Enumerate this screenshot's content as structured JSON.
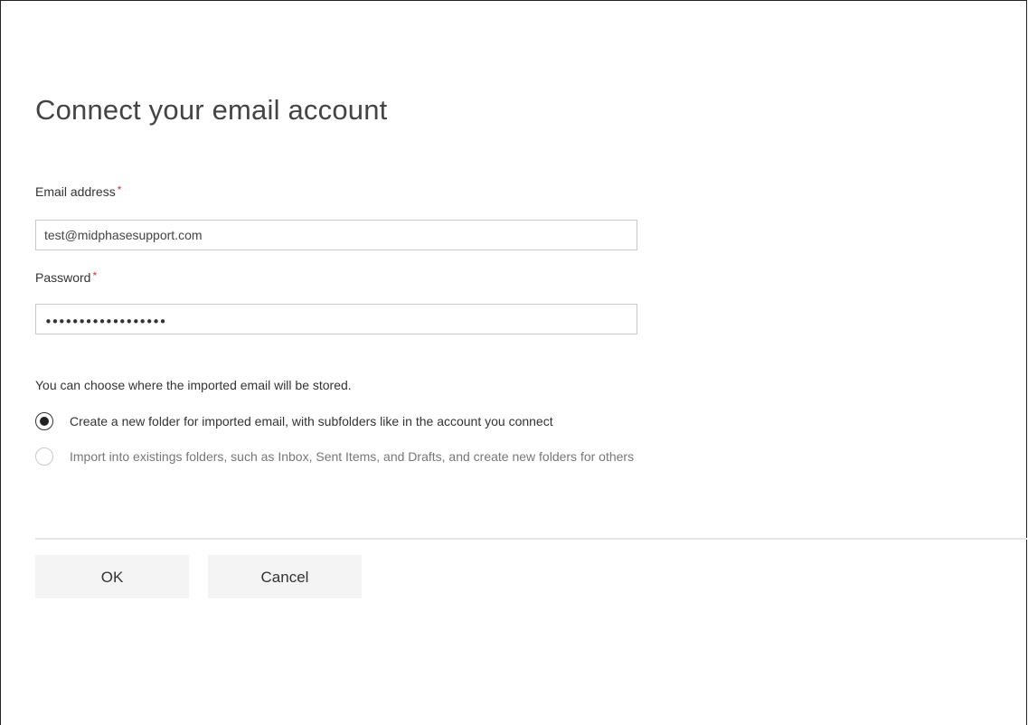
{
  "dialog": {
    "title": "Connect your email account"
  },
  "fields": {
    "email": {
      "label": "Email address",
      "required_mark": "*",
      "value": "test@midphasesupport.com"
    },
    "password": {
      "label": "Password",
      "required_mark": "*",
      "masked_value": "••••••••••••••••••"
    }
  },
  "storage": {
    "hint": "You can choose where the imported email will be stored.",
    "options": [
      {
        "label": "Create a new folder for imported email, with subfolders like in the account you connect",
        "selected": true
      },
      {
        "label": "Import into existings folders, such as Inbox, Sent Items, and Drafts, and create new folders for others",
        "selected": false
      }
    ]
  },
  "actions": {
    "ok_label": "OK",
    "cancel_label": "Cancel"
  },
  "colors": {
    "required": "#d13438",
    "button_bg": "#f4f4f4",
    "divider": "#e6e6e6"
  }
}
